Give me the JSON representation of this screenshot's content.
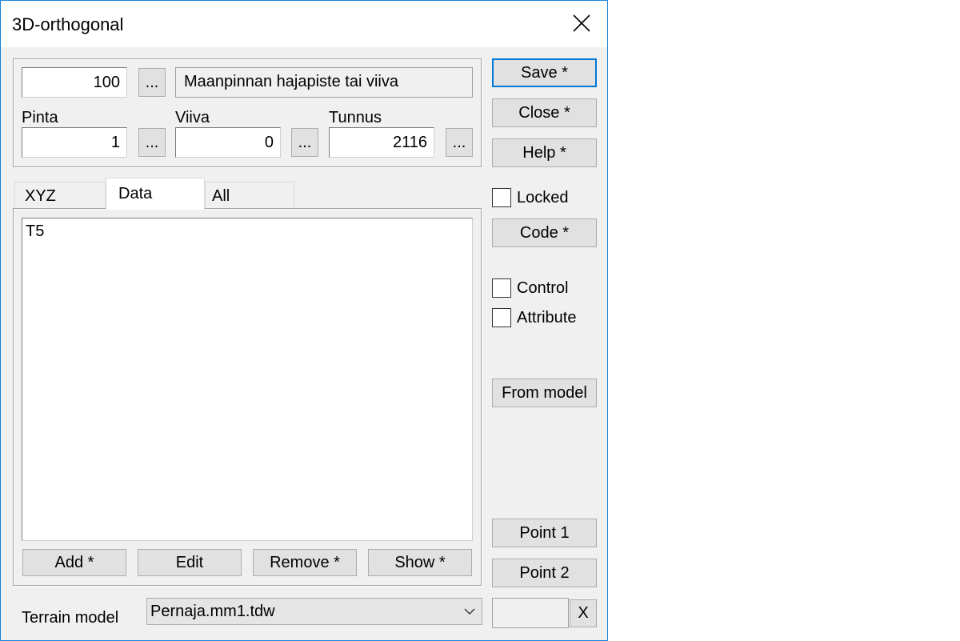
{
  "window": {
    "title": "3D-orthogonal",
    "close_glyph": "✕"
  },
  "code_row": {
    "number": "100",
    "browse": "...",
    "description": "Maanpinnan hajapiste tai viiva"
  },
  "fields": {
    "pinta": {
      "label": "Pinta",
      "value": "1",
      "browse": "..."
    },
    "viiva": {
      "label": "Viiva",
      "value": "0",
      "browse": "..."
    },
    "tunnus": {
      "label": "Tunnus",
      "value": "2116",
      "browse": "..."
    }
  },
  "tabs": [
    {
      "label": "XYZ",
      "active": false
    },
    {
      "label": "Data",
      "active": true
    },
    {
      "label": "All",
      "active": false
    }
  ],
  "data_list": {
    "items": [
      "T5"
    ]
  },
  "list_buttons": {
    "add": "Add *",
    "edit": "Edit",
    "remove": "Remove *",
    "show": "Show *"
  },
  "side_buttons": {
    "save": "Save *",
    "close": "Close *",
    "help": "Help *",
    "code": "Code *",
    "from_model": "From model",
    "point1": "Point 1",
    "point2": "Point 2",
    "clear": "X"
  },
  "checkboxes": {
    "locked": {
      "label": "Locked",
      "checked": false
    },
    "control": {
      "label": "Control",
      "checked": false
    },
    "attribute": {
      "label": "Attribute",
      "checked": false
    }
  },
  "terrain": {
    "label": "Terrain model",
    "value": "Pernaja.mm1.tdw",
    "extra_value": ""
  },
  "colors": {
    "dialog_bg": "#f0f0f0",
    "accent": "#0078d7",
    "window_border": "#1883d7"
  }
}
